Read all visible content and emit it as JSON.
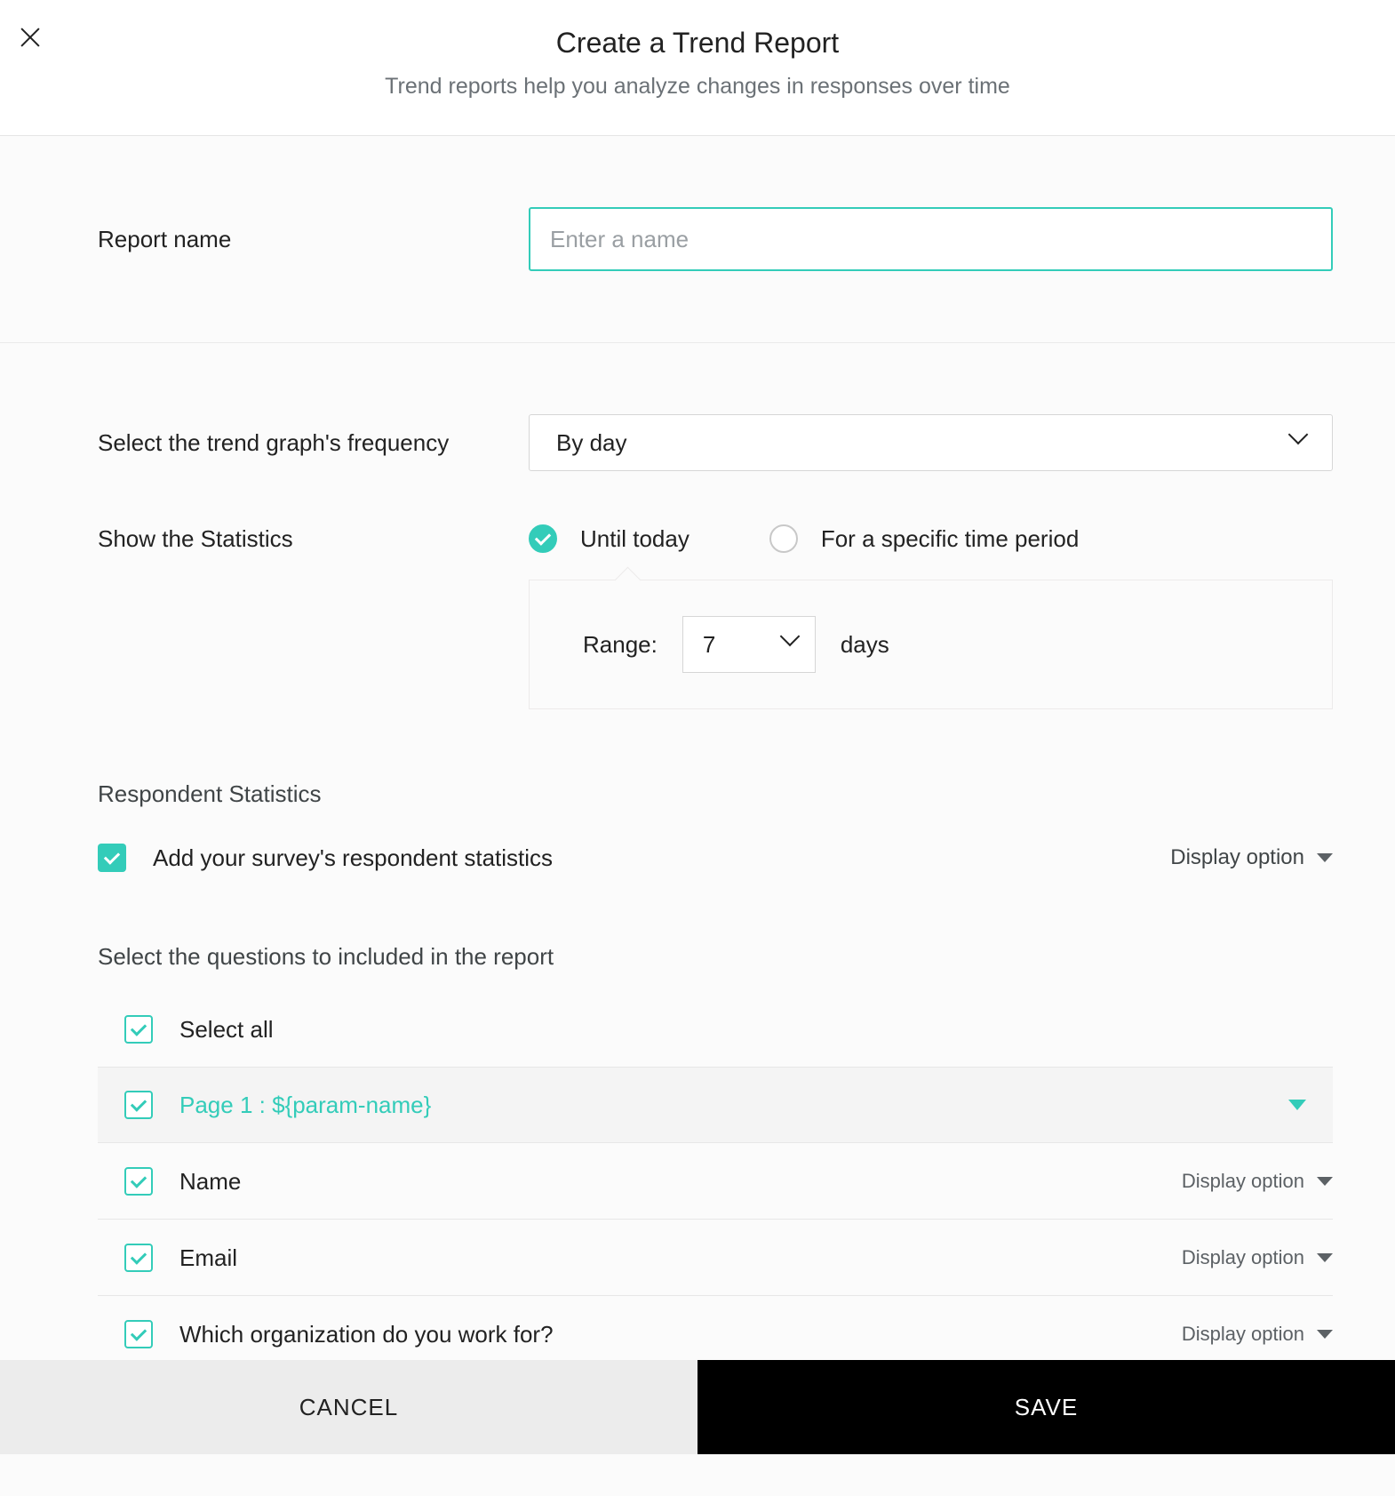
{
  "header": {
    "title": "Create a Trend Report",
    "subtitle": "Trend reports help you analyze changes in responses over time"
  },
  "report_name": {
    "label": "Report name",
    "placeholder": "Enter a name",
    "value": ""
  },
  "frequency": {
    "label": "Select the trend graph's frequency",
    "selected": "By day"
  },
  "statistics": {
    "label": "Show the Statistics",
    "options": {
      "until_today": "Until today",
      "specific_period": "For a specific time period"
    },
    "range_label": "Range:",
    "range_value": "7",
    "range_unit": "days"
  },
  "respondent_stats": {
    "heading": "Respondent Statistics",
    "add_label": "Add your survey's respondent statistics",
    "display_option": "Display option"
  },
  "questions": {
    "heading": "Select the questions to included in the report",
    "select_all": "Select all",
    "page_header": "Page 1 : ${param-name}",
    "items": [
      {
        "label": "Name",
        "display_option": "Display option"
      },
      {
        "label": "Email",
        "display_option": "Display option"
      },
      {
        "label": "Which organization do you work for?",
        "display_option": "Display option"
      }
    ]
  },
  "footer": {
    "cancel": "CANCEL",
    "save": "SAVE"
  }
}
